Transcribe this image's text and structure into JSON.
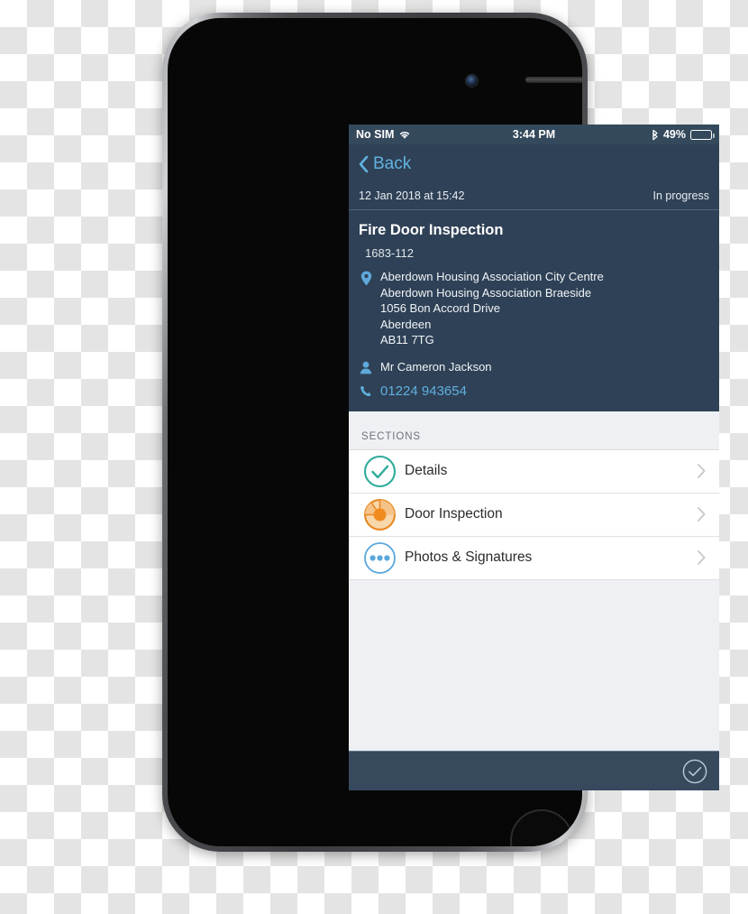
{
  "device": {
    "frame_name": "iphone-mockup",
    "body_color": "#3a3c3f",
    "home_button_name": "home-button",
    "earpiece_name": "earpiece-speaker",
    "camera_name": "front-camera"
  },
  "status_bar": {
    "carrier": "No SIM",
    "wifi_icon": "wifi-icon",
    "time": "3:44 PM",
    "bluetooth_icon": "bluetooth-icon",
    "battery_percent": "49%",
    "battery_level": 49,
    "background_color": "#34495c",
    "text_color": "#ffffff"
  },
  "nav_bar": {
    "back_label": "Back",
    "back_icon": "chevron-left-icon",
    "accent_color": "#62b2e0",
    "background_color": "#2f4156"
  },
  "detail_header": {
    "datetime": "12 Jan 2018 at 15:42",
    "status": "In progress",
    "title": "Fire Door Inspection",
    "reference": "1683-112",
    "location_icon": "map-pin-icon",
    "address": [
      "Aberdown Housing Association City Centre",
      "Aberdown Housing Association Braeside",
      "1056 Bon Accord Drive",
      "Aberdeen",
      "AB11 7TG"
    ],
    "contact_icon": "person-icon",
    "contact_name": "Mr Cameron Jackson",
    "phone_icon": "phone-handset-icon",
    "phone_number": "01224 943654",
    "phone_link_color": "#5fb0df",
    "background_color": "#2f4156"
  },
  "sections": {
    "label": "SECTIONS",
    "items": [
      {
        "label": "Details",
        "status": "complete",
        "icon": "check-circle-icon",
        "color": "#2fab9b",
        "chevron": "chevron-right-icon"
      },
      {
        "label": "Door Inspection",
        "status": "in-progress",
        "icon": "pie-progress-icon",
        "color": "#f08b1d",
        "chevron": "chevron-right-icon"
      },
      {
        "label": "Photos & Signatures",
        "status": "not-started",
        "icon": "ellipsis-circle-icon",
        "color": "#5aa7dd",
        "chevron": "chevron-right-icon"
      }
    ],
    "background_color": "#eff0f4",
    "row_background_color": "#ffffff"
  },
  "bottom_bar": {
    "complete_icon": "check-circle-outline-icon",
    "icon_color": "#b9ccdd",
    "background_color": "#37495d"
  }
}
